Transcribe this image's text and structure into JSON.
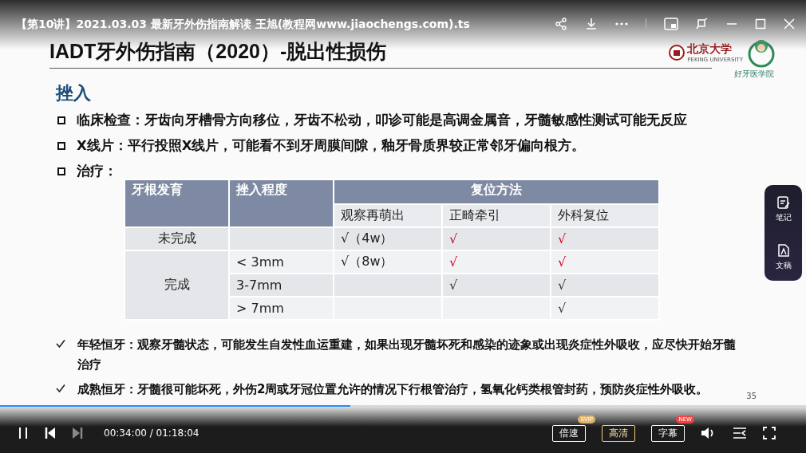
{
  "window": {
    "title": "【第10讲】2021.03.03  最新牙外伤指南解读 王旭(教程网www.jiaochengs.com).ts"
  },
  "slide": {
    "title": "IADT牙外伤指南（2020）-脱出性损伤",
    "logo": {
      "name": "北京大学",
      "subtitle": "PEKING UNIVERSITY",
      "caption": "好牙医学院"
    },
    "section": "挫入",
    "bullets": [
      {
        "kind": "square",
        "text": "临床检查：牙齿向牙槽骨方向移位，牙齿不松动，叩诊可能是高调金属音，牙髓敏感性测试可能无反应"
      },
      {
        "kind": "square",
        "text": "X线片：平行投照X线片，可能看不到牙周膜间隙，釉牙骨质界较正常邻牙偏向根方。"
      },
      {
        "kind": "square",
        "text": "治疗："
      }
    ],
    "table": {
      "head": [
        "牙根发育",
        "挫入程度",
        "复位方法"
      ],
      "subhead": [
        "观察再萌出",
        "正畸牵引",
        "外科复位"
      ],
      "rows": [
        {
          "group": "未完成",
          "cells": [
            "",
            "√（4w）",
            {
              "text": "√",
              "color": "#d0021b"
            },
            {
              "text": "√",
              "color": "#d0021b"
            }
          ]
        },
        {
          "group": "完成",
          "cells": [
            "< 3mm",
            "√（8w）",
            {
              "text": "√",
              "color": "#d0021b"
            },
            {
              "text": "√",
              "color": "#d0021b"
            }
          ]
        },
        {
          "cells": [
            "3-7mm",
            "",
            {
              "text": "√",
              "color": "#333333"
            },
            {
              "text": "√",
              "color": "#333333"
            }
          ]
        },
        {
          "cells": [
            "> 7mm",
            "",
            "",
            {
              "text": "√",
              "color": "#333333"
            }
          ]
        }
      ]
    },
    "notes": [
      {
        "kind": "check",
        "text": "年轻恒牙：观察牙髓状态，可能发生自发性血运重建，如果出现牙髓坏死和感染的迹象或出现炎症性外吸收，应尽快开始牙髓治疗"
      },
      {
        "kind": "check",
        "text": "成熟恒牙：牙髓很可能坏死，外伤2周或牙冠位置允许的情况下行根管治疗，氢氧化钙类根管封药，预防炎症性外吸收。"
      }
    ],
    "page_number": "35"
  },
  "side_panel": [
    {
      "kind": "note",
      "label": "笔记"
    },
    {
      "kind": "doc",
      "label": "文稿"
    }
  ],
  "player": {
    "progress": {
      "level": 0.435
    },
    "time": "00:34:00 / 01:18:04",
    "buttons": [
      {
        "label": "倍速",
        "selected": false,
        "badge": {
          "text": "SVIP",
          "color": "#e0b36a"
        }
      },
      {
        "label": "高清",
        "selected": true
      },
      {
        "label": "字幕",
        "selected": false,
        "badge": {
          "text": "NEW",
          "color": "#f04545"
        }
      }
    ]
  }
}
